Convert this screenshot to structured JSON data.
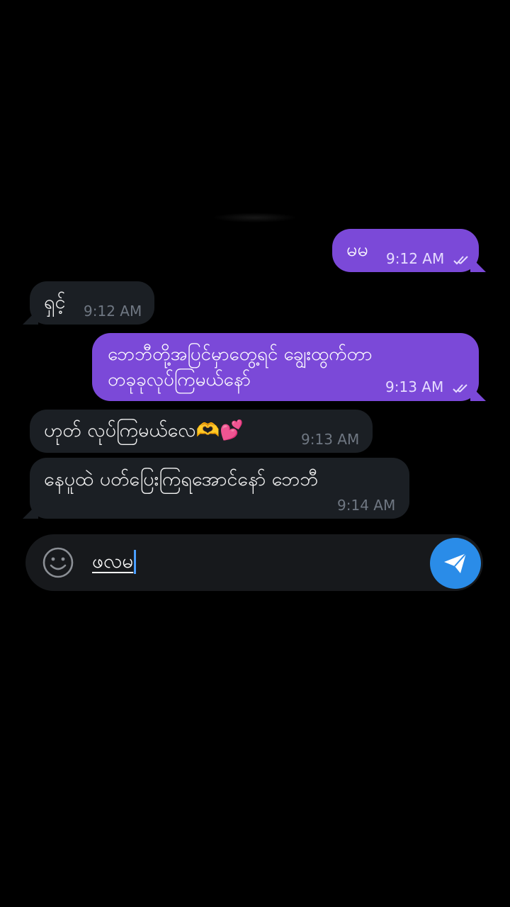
{
  "messages": [
    {
      "side": "out",
      "text": "မမ",
      "time": "9:12 AM"
    },
    {
      "side": "in",
      "text": "ရှင့်",
      "time": "9:12 AM"
    },
    {
      "side": "out",
      "line1": "ဘေဘီတို့အပြင်မှာတွေ့ရင် ချွေးထွက်တာ",
      "line2": "တခုခုလုပ်ကြမယ်နော်",
      "time": "9:13 AM"
    },
    {
      "side": "in",
      "text": "ဟုတ် လုပ်ကြမယ်လေ🫶💕",
      "time": "9:13 AM"
    },
    {
      "side": "in",
      "text": "နေပူထဲ ပတ်ပြေးကြရအောင်နော် ဘေဘီ",
      "time": "9:14 AM"
    }
  ],
  "composer": {
    "text": "ဖလမ",
    "emoji_icon": "smiley-icon",
    "send_icon": "paper-plane-icon"
  },
  "colors": {
    "background": "#000000",
    "outgoing_bubble": "#7b49d8",
    "incoming_bubble": "#1b1f24",
    "send_button": "#2a8ce8",
    "caret": "#4a9eff"
  }
}
